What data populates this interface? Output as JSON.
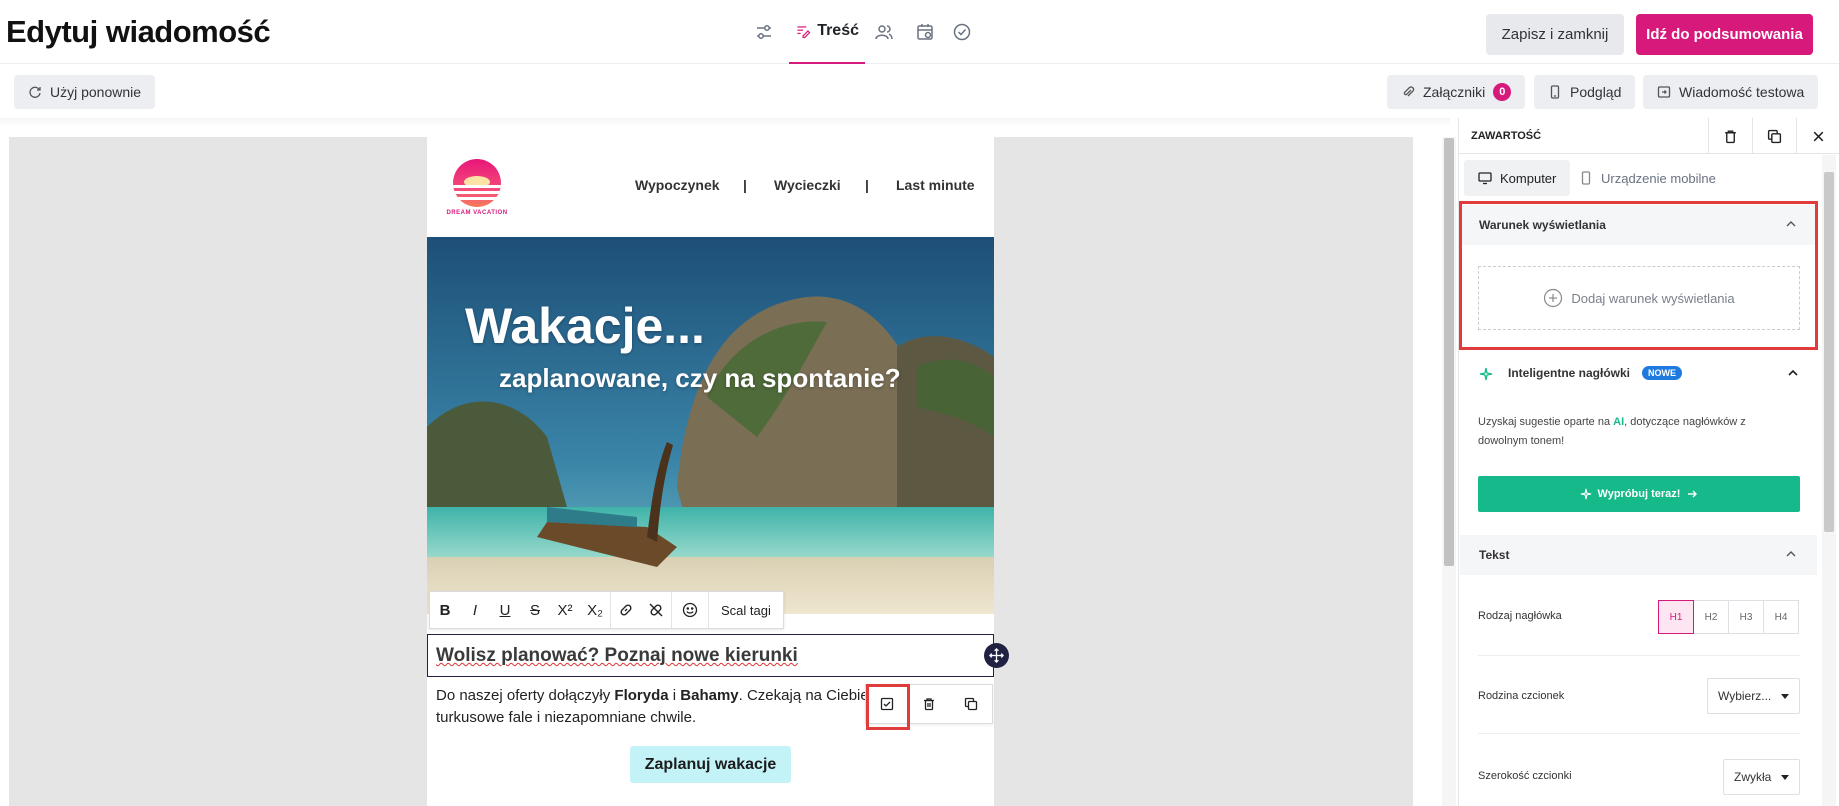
{
  "header": {
    "title": "Edytuj wiadomość",
    "steps": [
      {
        "icon": "sliders-icon",
        "label": ""
      },
      {
        "icon": "edit-content-icon",
        "label": "Treść",
        "active": true
      },
      {
        "icon": "users-icon",
        "label": ""
      },
      {
        "icon": "calendar-icon",
        "label": ""
      },
      {
        "icon": "check-circle-icon",
        "label": ""
      }
    ],
    "save_close_label": "Zapisz i zamknij",
    "summary_label": "Idź do podsumowania",
    "accent_color": "#d6197a"
  },
  "toolbar": {
    "reuse_label": "Użyj ponownie",
    "attachments_label": "Załączniki",
    "attachments_count": "0",
    "preview_label": "Podgląd",
    "test_message_label": "Wiadomość testowa"
  },
  "email": {
    "logo_text": "DREAM VACATION",
    "menu": [
      "Wypoczynek",
      "|",
      "Wycieczki",
      "|",
      "Last minute"
    ],
    "hero_title": "Wakacje...",
    "hero_subtitle": "zaplanowane, czy na spontanie?",
    "format_toolbar": {
      "buttons": [
        "B",
        "I",
        "U",
        "S",
        "X²",
        "X₂"
      ],
      "merge_tags_label": "Scal tagi"
    },
    "headline": "Wolisz planować? Poznaj nowe kierunki",
    "body_prefix": "Do naszej oferty dołączyły ",
    "body_bold1": "Floryda",
    "body_mid": " i ",
    "body_bold2": "Bahamy",
    "body_rest": ". Czekają na Ciebie z",
    "body_line2": "turkusowe fale i niezapomniane chwile.",
    "cta_label": "Zaplanuj wakacje"
  },
  "panel": {
    "title": "ZAWARTOŚĆ",
    "device_tabs": [
      "Komputer",
      "Urządzenie mobilne"
    ],
    "display_condition": {
      "title": "Warunek wyświetlania",
      "add_label": "Dodaj warunek wyświetlania"
    },
    "smart_headers": {
      "title": "Inteligentne nagłówki",
      "badge": "NOWE",
      "desc_before": "Uzyskaj sugestie oparte na ",
      "desc_ai": "AI",
      "desc_after": ", dotyczące nagłówków z dowolnym tonem!",
      "button_label": "Wypróbuj teraz!"
    },
    "text": {
      "title": "Tekst",
      "heading_type_label": "Rodzaj nagłówka",
      "heading_options": [
        "H1",
        "H2",
        "H3",
        "H4"
      ],
      "heading_selected": "H1",
      "font_family_label": "Rodzina czcionek",
      "font_family_value": "Wybierz...",
      "font_width_label": "Szerokość czcionki",
      "font_width_value": "Zwykła"
    }
  }
}
